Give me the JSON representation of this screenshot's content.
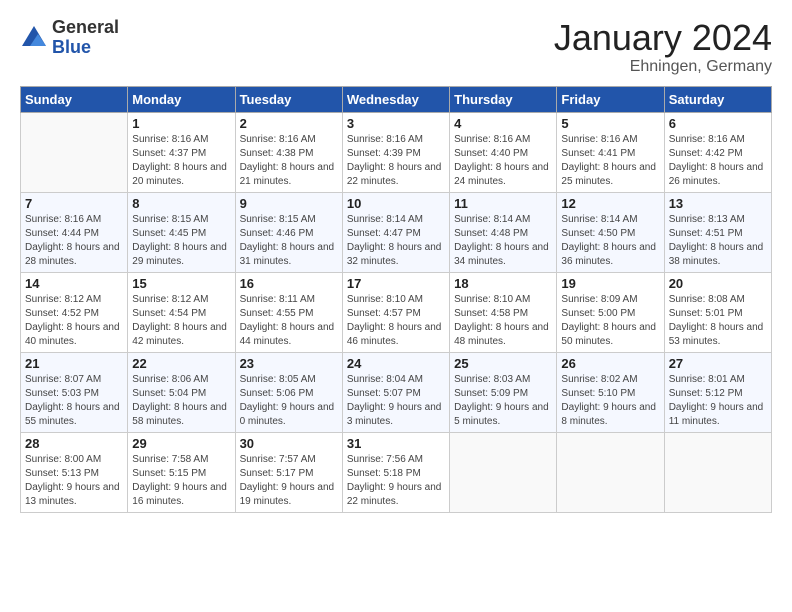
{
  "header": {
    "logo_general": "General",
    "logo_blue": "Blue",
    "month_title": "January 2024",
    "location": "Ehningen, Germany"
  },
  "weekdays": [
    "Sunday",
    "Monday",
    "Tuesday",
    "Wednesday",
    "Thursday",
    "Friday",
    "Saturday"
  ],
  "weeks": [
    [
      {
        "day": "",
        "sunrise": "",
        "sunset": "",
        "daylight": ""
      },
      {
        "day": "1",
        "sunrise": "8:16 AM",
        "sunset": "4:37 PM",
        "daylight": "8 hours and 20 minutes."
      },
      {
        "day": "2",
        "sunrise": "8:16 AM",
        "sunset": "4:38 PM",
        "daylight": "8 hours and 21 minutes."
      },
      {
        "day": "3",
        "sunrise": "8:16 AM",
        "sunset": "4:39 PM",
        "daylight": "8 hours and 22 minutes."
      },
      {
        "day": "4",
        "sunrise": "8:16 AM",
        "sunset": "4:40 PM",
        "daylight": "8 hours and 24 minutes."
      },
      {
        "day": "5",
        "sunrise": "8:16 AM",
        "sunset": "4:41 PM",
        "daylight": "8 hours and 25 minutes."
      },
      {
        "day": "6",
        "sunrise": "8:16 AM",
        "sunset": "4:42 PM",
        "daylight": "8 hours and 26 minutes."
      }
    ],
    [
      {
        "day": "7",
        "sunrise": "8:16 AM",
        "sunset": "4:44 PM",
        "daylight": "8 hours and 28 minutes."
      },
      {
        "day": "8",
        "sunrise": "8:15 AM",
        "sunset": "4:45 PM",
        "daylight": "8 hours and 29 minutes."
      },
      {
        "day": "9",
        "sunrise": "8:15 AM",
        "sunset": "4:46 PM",
        "daylight": "8 hours and 31 minutes."
      },
      {
        "day": "10",
        "sunrise": "8:14 AM",
        "sunset": "4:47 PM",
        "daylight": "8 hours and 32 minutes."
      },
      {
        "day": "11",
        "sunrise": "8:14 AM",
        "sunset": "4:48 PM",
        "daylight": "8 hours and 34 minutes."
      },
      {
        "day": "12",
        "sunrise": "8:14 AM",
        "sunset": "4:50 PM",
        "daylight": "8 hours and 36 minutes."
      },
      {
        "day": "13",
        "sunrise": "8:13 AM",
        "sunset": "4:51 PM",
        "daylight": "8 hours and 38 minutes."
      }
    ],
    [
      {
        "day": "14",
        "sunrise": "8:12 AM",
        "sunset": "4:52 PM",
        "daylight": "8 hours and 40 minutes."
      },
      {
        "day": "15",
        "sunrise": "8:12 AM",
        "sunset": "4:54 PM",
        "daylight": "8 hours and 42 minutes."
      },
      {
        "day": "16",
        "sunrise": "8:11 AM",
        "sunset": "4:55 PM",
        "daylight": "8 hours and 44 minutes."
      },
      {
        "day": "17",
        "sunrise": "8:10 AM",
        "sunset": "4:57 PM",
        "daylight": "8 hours and 46 minutes."
      },
      {
        "day": "18",
        "sunrise": "8:10 AM",
        "sunset": "4:58 PM",
        "daylight": "8 hours and 48 minutes."
      },
      {
        "day": "19",
        "sunrise": "8:09 AM",
        "sunset": "5:00 PM",
        "daylight": "8 hours and 50 minutes."
      },
      {
        "day": "20",
        "sunrise": "8:08 AM",
        "sunset": "5:01 PM",
        "daylight": "8 hours and 53 minutes."
      }
    ],
    [
      {
        "day": "21",
        "sunrise": "8:07 AM",
        "sunset": "5:03 PM",
        "daylight": "8 hours and 55 minutes."
      },
      {
        "day": "22",
        "sunrise": "8:06 AM",
        "sunset": "5:04 PM",
        "daylight": "8 hours and 58 minutes."
      },
      {
        "day": "23",
        "sunrise": "8:05 AM",
        "sunset": "5:06 PM",
        "daylight": "9 hours and 0 minutes."
      },
      {
        "day": "24",
        "sunrise": "8:04 AM",
        "sunset": "5:07 PM",
        "daylight": "9 hours and 3 minutes."
      },
      {
        "day": "25",
        "sunrise": "8:03 AM",
        "sunset": "5:09 PM",
        "daylight": "9 hours and 5 minutes."
      },
      {
        "day": "26",
        "sunrise": "8:02 AM",
        "sunset": "5:10 PM",
        "daylight": "9 hours and 8 minutes."
      },
      {
        "day": "27",
        "sunrise": "8:01 AM",
        "sunset": "5:12 PM",
        "daylight": "9 hours and 11 minutes."
      }
    ],
    [
      {
        "day": "28",
        "sunrise": "8:00 AM",
        "sunset": "5:13 PM",
        "daylight": "9 hours and 13 minutes."
      },
      {
        "day": "29",
        "sunrise": "7:58 AM",
        "sunset": "5:15 PM",
        "daylight": "9 hours and 16 minutes."
      },
      {
        "day": "30",
        "sunrise": "7:57 AM",
        "sunset": "5:17 PM",
        "daylight": "9 hours and 19 minutes."
      },
      {
        "day": "31",
        "sunrise": "7:56 AM",
        "sunset": "5:18 PM",
        "daylight": "9 hours and 22 minutes."
      },
      {
        "day": "",
        "sunrise": "",
        "sunset": "",
        "daylight": ""
      },
      {
        "day": "",
        "sunrise": "",
        "sunset": "",
        "daylight": ""
      },
      {
        "day": "",
        "sunrise": "",
        "sunset": "",
        "daylight": ""
      }
    ]
  ],
  "labels": {
    "sunrise_prefix": "Sunrise: ",
    "sunset_prefix": "Sunset: ",
    "daylight_prefix": "Daylight: "
  }
}
